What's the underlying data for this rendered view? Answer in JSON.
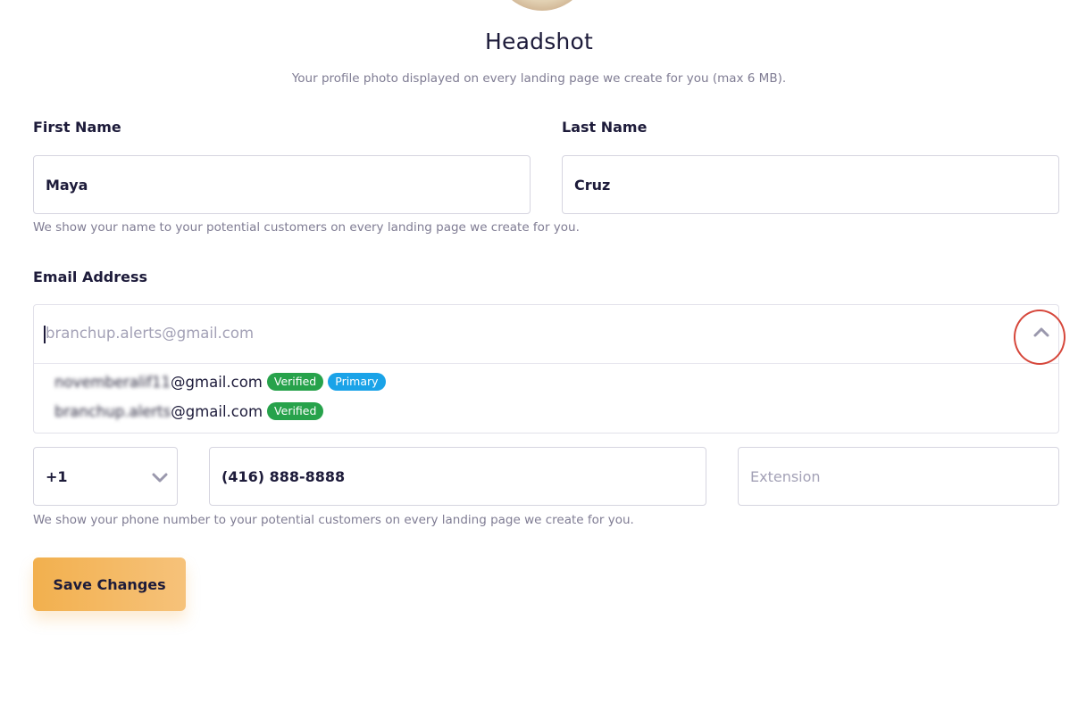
{
  "headshot": {
    "title": "Headshot",
    "help": "Your profile photo displayed on every landing page we create for you (max 6 MB)."
  },
  "name": {
    "first_label": "First Name",
    "first_value": "Maya",
    "last_label": "Last Name",
    "last_value": "Cruz",
    "help": "We show your name to your potential customers on every landing page we create for you."
  },
  "email": {
    "label": "Email Address",
    "placeholder": "branchup.alerts@gmail.com",
    "options": [
      {
        "local_blurred": "novemberalif11",
        "domain": "@gmail.com",
        "badges": [
          "Verified",
          "Primary"
        ]
      },
      {
        "local_blurred": "branchup.alerts",
        "domain": "@gmail.com",
        "badges": [
          "Verified"
        ]
      }
    ]
  },
  "phone": {
    "country_code": "+1",
    "number": "(416) 888-8888",
    "extension_placeholder": "Extension",
    "help": "We show your phone number to your potential customers on every landing page we create for you."
  },
  "actions": {
    "save_label": "Save Changes"
  },
  "colors": {
    "accent": "#f2b04e",
    "verified": "#27a24b",
    "primary_badge": "#1aa3e8",
    "annotation": "#d6473b"
  }
}
